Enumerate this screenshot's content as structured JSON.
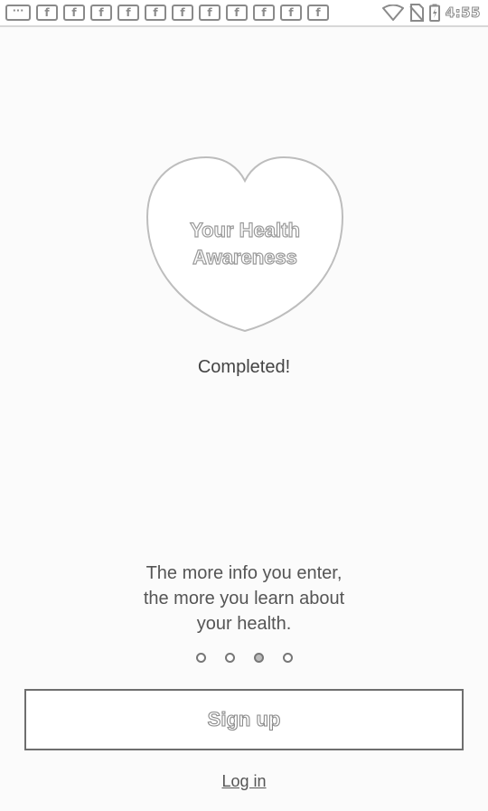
{
  "status_bar": {
    "notification_icons": [
      "more-notifications-icon",
      "facebook-icon",
      "facebook-icon",
      "facebook-icon",
      "facebook-icon",
      "facebook-icon",
      "facebook-icon",
      "facebook-icon",
      "facebook-icon",
      "facebook-icon",
      "facebook-icon",
      "facebook-icon"
    ],
    "more_glyph": "···",
    "facebook_glyph": "f",
    "time": "4:55"
  },
  "heart": {
    "line1": "Your Health",
    "line2": "Awareness",
    "outline_color": "#bdbdbd"
  },
  "status_text": "Completed!",
  "info": {
    "line1": "The more info you enter,",
    "line2": "the more you learn about",
    "line3": "your health."
  },
  "pager": {
    "count": 4,
    "active_index": 2
  },
  "actions": {
    "signup_label": "Sign up",
    "login_label": "Log in"
  }
}
